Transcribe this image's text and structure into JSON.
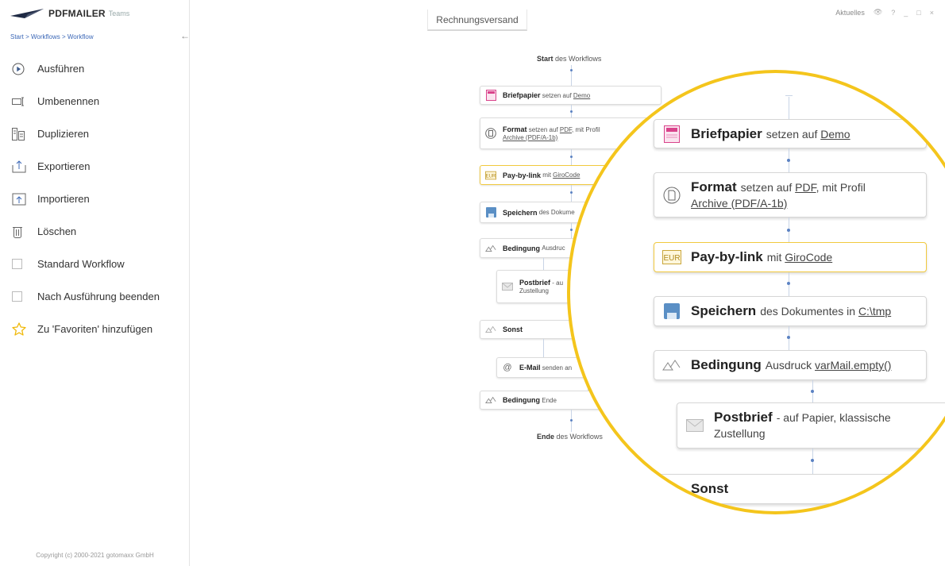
{
  "app": {
    "name": "PDFMAILER",
    "edition": "Teams"
  },
  "breadcrumb": "Start > Workflows > Workflow",
  "window": {
    "tab_title": "Rechnungsversand",
    "aktuelles": "Aktuelles",
    "help": "?",
    "minimize": "_",
    "maximize": "□",
    "close": "×"
  },
  "menu": [
    {
      "label": "Ausführen",
      "icon": "play-icon"
    },
    {
      "label": "Umbenennen",
      "icon": "rename-icon"
    },
    {
      "label": "Duplizieren",
      "icon": "duplicate-icon"
    },
    {
      "label": "Exportieren",
      "icon": "export-icon"
    },
    {
      "label": "Importieren",
      "icon": "import-icon"
    },
    {
      "label": "Löschen",
      "icon": "trash-icon"
    },
    {
      "label": "Standard Workflow",
      "icon": "checkbox"
    },
    {
      "label": "Nach Ausführung beenden",
      "icon": "checkbox"
    },
    {
      "label": "Zu 'Favoriten' hinzufügen",
      "icon": "star-icon"
    }
  ],
  "copyright": "Copyright (c) 2000-2021 gotomaxx GmbH",
  "workflow": {
    "start": {
      "bold": "Start",
      "rest": "des Workflows"
    },
    "end": {
      "bold": "Ende",
      "rest": "des Workflows"
    },
    "steps": {
      "briefpapier": {
        "bold": "Briefpapier",
        "text": "setzen auf",
        "link": "Demo"
      },
      "format": {
        "bold": "Format",
        "text": "setzen auf",
        "link": "PDF",
        "text2": ", mit Profil",
        "link2": "Archive (PDF/A-1b)"
      },
      "paybylink": {
        "bold": "Pay-by-link",
        "text": "mit",
        "link": "GiroCode",
        "icon_text": "EUR"
      },
      "speichern": {
        "bold": "Speichern",
        "text_small": "des Dokume",
        "text": "des Dokumentes in",
        "link": "C:\\tmp"
      },
      "bedingung": {
        "bold": "Bedingung",
        "text_small": "Ausdruc",
        "text": "Ausdruck",
        "link": "varMail.empty()"
      },
      "postbrief": {
        "bold": "Postbrief",
        "text_small": "- au",
        "line2": "Zustellung",
        "text": "- auf Papier, klassische"
      },
      "sonst": {
        "bold": "Sonst"
      },
      "email": {
        "bold": "E-Mail",
        "text": "senden an"
      },
      "bedingung_ende": {
        "bold": "Bedingung",
        "text": "Ende"
      }
    }
  },
  "colors": {
    "accent": "#f4c51c",
    "link": "#3c68b7",
    "connector_dot": "#5b82c3",
    "briefpapier_icon": "#d9438b",
    "save_icon": "#5a8fc5"
  }
}
